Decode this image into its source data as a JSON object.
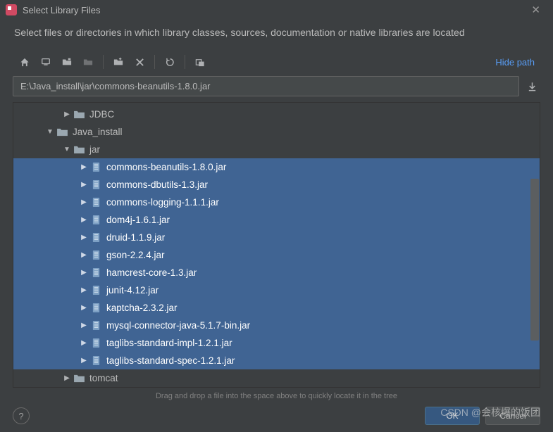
{
  "window": {
    "title": "Select Library Files",
    "subtitle": "Select files or directories in which library classes, sources, documentation or native libraries are located"
  },
  "toolbar": {
    "hide_path_label": "Hide path"
  },
  "path": {
    "value": "E:\\Java_install\\jar\\commons-beanutils-1.8.0.jar"
  },
  "tree": {
    "items": [
      {
        "label": "JDBC",
        "depth": 2,
        "expanded": false,
        "type": "folder",
        "selected": false
      },
      {
        "label": "Java_install",
        "depth": 1,
        "expanded": true,
        "type": "folder",
        "selected": false
      },
      {
        "label": "jar",
        "depth": 2,
        "expanded": true,
        "type": "folder",
        "selected": false
      },
      {
        "label": "commons-beanutils-1.8.0.jar",
        "depth": 3,
        "expanded": false,
        "type": "jar",
        "selected": true
      },
      {
        "label": "commons-dbutils-1.3.jar",
        "depth": 3,
        "expanded": false,
        "type": "jar",
        "selected": true
      },
      {
        "label": "commons-logging-1.1.1.jar",
        "depth": 3,
        "expanded": false,
        "type": "jar",
        "selected": true
      },
      {
        "label": "dom4j-1.6.1.jar",
        "depth": 3,
        "expanded": false,
        "type": "jar",
        "selected": true
      },
      {
        "label": "druid-1.1.9.jar",
        "depth": 3,
        "expanded": false,
        "type": "jar",
        "selected": true
      },
      {
        "label": "gson-2.2.4.jar",
        "depth": 3,
        "expanded": false,
        "type": "jar",
        "selected": true
      },
      {
        "label": "hamcrest-core-1.3.jar",
        "depth": 3,
        "expanded": false,
        "type": "jar",
        "selected": true
      },
      {
        "label": "junit-4.12.jar",
        "depth": 3,
        "expanded": false,
        "type": "jar",
        "selected": true
      },
      {
        "label": "kaptcha-2.3.2.jar",
        "depth": 3,
        "expanded": false,
        "type": "jar",
        "selected": true
      },
      {
        "label": "mysql-connector-java-5.1.7-bin.jar",
        "depth": 3,
        "expanded": false,
        "type": "jar",
        "selected": true
      },
      {
        "label": "taglibs-standard-impl-1.2.1.jar",
        "depth": 3,
        "expanded": false,
        "type": "jar",
        "selected": true
      },
      {
        "label": "taglibs-standard-spec-1.2.1.jar",
        "depth": 3,
        "expanded": false,
        "type": "jar",
        "selected": true
      },
      {
        "label": "tomcat",
        "depth": 2,
        "expanded": false,
        "type": "folder",
        "selected": false
      }
    ]
  },
  "hint": "Drag and drop a file into the space above to quickly locate it in the tree",
  "footer": {
    "ok_label": "OK",
    "cancel_label": "Cancel",
    "help_label": "?"
  },
  "watermark": "CSDN @会核爆的饭团"
}
